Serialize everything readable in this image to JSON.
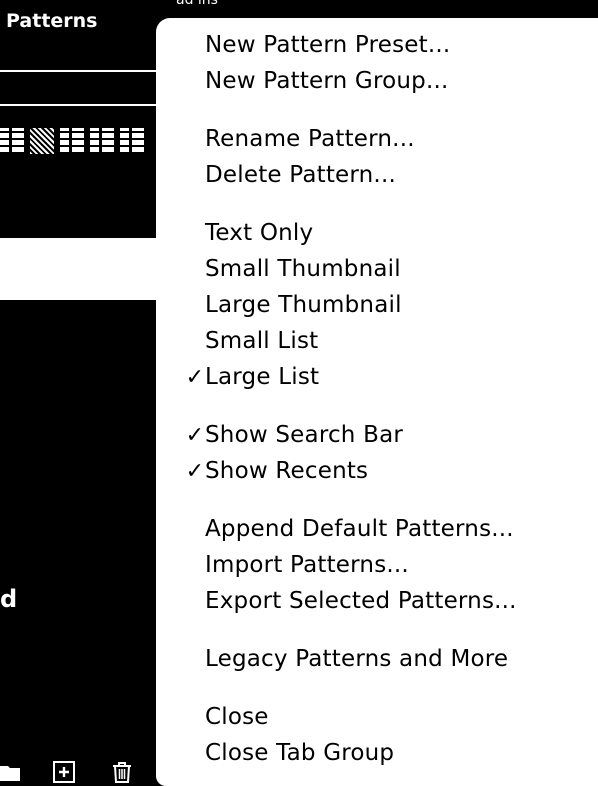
{
  "panel": {
    "title": "Patterns",
    "cut_label": "d",
    "top_fragment": "ad ins"
  },
  "menu": {
    "items": [
      {
        "label": "New Pattern Preset...",
        "checked": false
      },
      {
        "label": "New Pattern Group...",
        "checked": false
      },
      {
        "label": "Rename Pattern...",
        "checked": false
      },
      {
        "label": "Delete Pattern...",
        "checked": false
      },
      {
        "label": "Text Only",
        "checked": false
      },
      {
        "label": "Small Thumbnail",
        "checked": false
      },
      {
        "label": "Large Thumbnail",
        "checked": false
      },
      {
        "label": "Small List",
        "checked": false
      },
      {
        "label": "Large List",
        "checked": true,
        "check": "✓"
      },
      {
        "label": "Show Search Bar",
        "checked": true,
        "check": "✓"
      },
      {
        "label": "Show Recents",
        "checked": true,
        "check": "✓"
      },
      {
        "label": "Append Default Patterns...",
        "checked": false
      },
      {
        "label": "Import Patterns...",
        "checked": false
      },
      {
        "label": "Export Selected Patterns...",
        "checked": false
      },
      {
        "label": "Legacy Patterns and More",
        "checked": false
      },
      {
        "label": "Close",
        "checked": false
      },
      {
        "label": "Close Tab Group",
        "checked": false
      }
    ]
  },
  "icons": {
    "folder": "folder-icon",
    "add": "add-pattern-icon",
    "trash": "trash-icon",
    "check": "checkmark-icon"
  },
  "colors": {
    "panel_bg": "#000000",
    "menu_bg": "#ffffff",
    "text": "#000000"
  }
}
